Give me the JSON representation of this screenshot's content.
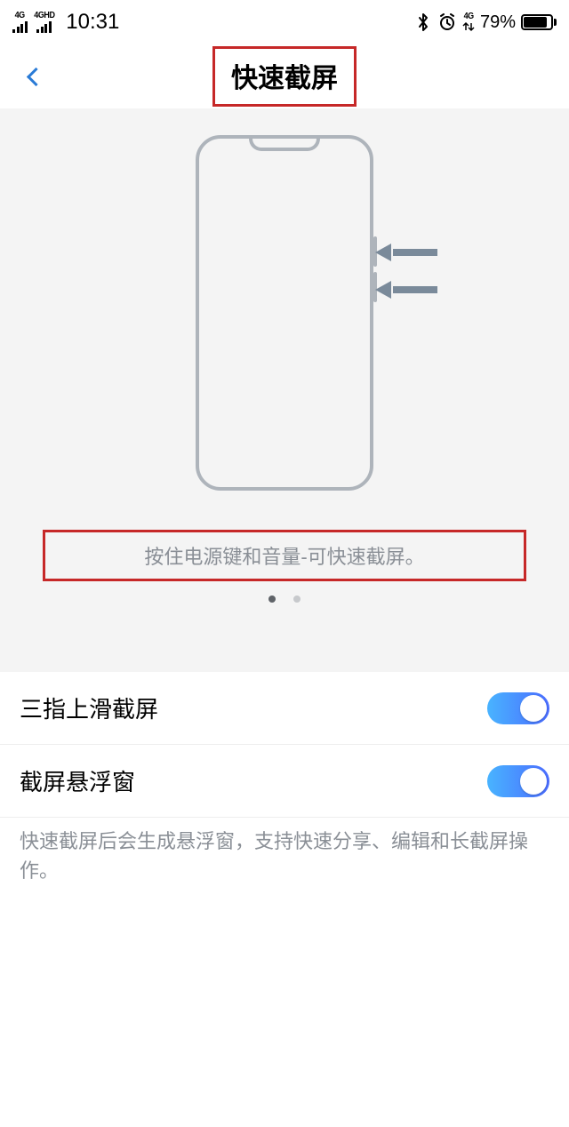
{
  "status": {
    "net_label_1": "4G",
    "net_label_2": "4GHD",
    "time": "10:31",
    "data_icon_label": "4G",
    "battery_percent": "79%"
  },
  "header": {
    "title": "快速截屏"
  },
  "illustration": {
    "hint": "按住电源键和音量-可快速截屏。",
    "page_index": 0,
    "page_count": 2
  },
  "settings": {
    "items": [
      {
        "label": "三指上滑截屏",
        "enabled": true
      },
      {
        "label": "截屏悬浮窗",
        "enabled": true
      }
    ],
    "description": "快速截屏后会生成悬浮窗，支持快速分享、编辑和长截屏操作。"
  }
}
